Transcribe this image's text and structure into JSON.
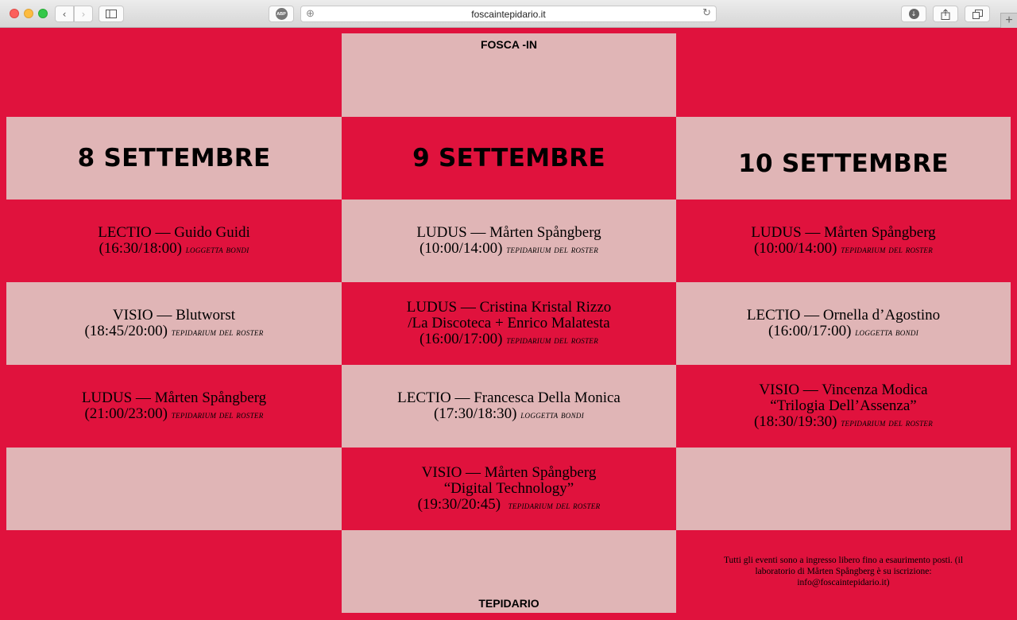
{
  "browser": {
    "url": "foscaintepidario.it",
    "abp_label": "ABP",
    "back_glyph": "‹",
    "forward_glyph": "›",
    "plus_glyph": "⊕",
    "reload_glyph": "↻",
    "newtab_glyph": "+",
    "icons": [
      "back-icon",
      "forward-icon",
      "sidebar-icon",
      "adblock-icon",
      "reload-icon",
      "download-icon",
      "share-icon",
      "tabs-icon",
      "new-tab-icon"
    ]
  },
  "header": {
    "top_label": "FOSCA -IN",
    "bottom_label": "TEPIDARIO"
  },
  "days": [
    "8 SETTEMBRE",
    "9 SETTEMBRE",
    "10 SETTEMBRE"
  ],
  "events": {
    "d8": [
      {
        "lines": [
          "LECTIO — Guido Guidi"
        ],
        "time": "(16:30/18:00)",
        "place": "Loggetta Bondi"
      },
      {
        "lines": [
          "VISIO — Blutworst"
        ],
        "time": "(18:45/20:00)",
        "place": "Tepidarium del Roster"
      },
      {
        "lines": [
          "LUDUS — Mårten Spångberg"
        ],
        "time": "(21:00/23:00)",
        "place": "Tepidarium del Roster"
      }
    ],
    "d9": [
      {
        "lines": [
          "LUDUS — Mårten Spångberg"
        ],
        "time": "(10:00/14:00)",
        "place": "Tepidarium del Roster"
      },
      {
        "lines": [
          "LUDUS — Cristina Kristal Rizzo",
          "/La Discoteca + Enrico Malatesta"
        ],
        "time": "(16:00/17:00)",
        "place": "Tepidarium del Roster"
      },
      {
        "lines": [
          "LECTIO — Francesca Della Monica"
        ],
        "time": "(17:30/18:30)",
        "place": "Loggetta Bondi"
      },
      {
        "lines": [
          "VISIO — Mårten Spångberg",
          "“Digital Technology”"
        ],
        "time": "(19:30/20:45)",
        "place": "Tepidarium del Roster"
      }
    ],
    "d10": [
      {
        "lines": [
          "LUDUS — Mårten Spångberg"
        ],
        "time": "(10:00/14:00)",
        "place": "Tepidarium del Roster"
      },
      {
        "lines": [
          "LECTIO — Ornella d’Agostino"
        ],
        "time": "(16:00/17:00)",
        "place": "Loggetta Bondi"
      },
      {
        "lines": [
          "VISIO — Vincenza Modica",
          "“Trilogia Dell’Assenza”"
        ],
        "time": "(18:30/19:30)",
        "place": "Tepidarium del Roster"
      }
    ]
  },
  "footer_note": "Tutti gli eventi sono a ingresso libero fino a esaurimento posti. (il laboratorio di Mårten Spångberg è su iscrizione: info@foscaintepidario.it)",
  "colors": {
    "red": "#e0123d",
    "pink": "#e0b5b6",
    "text": "#000000"
  }
}
